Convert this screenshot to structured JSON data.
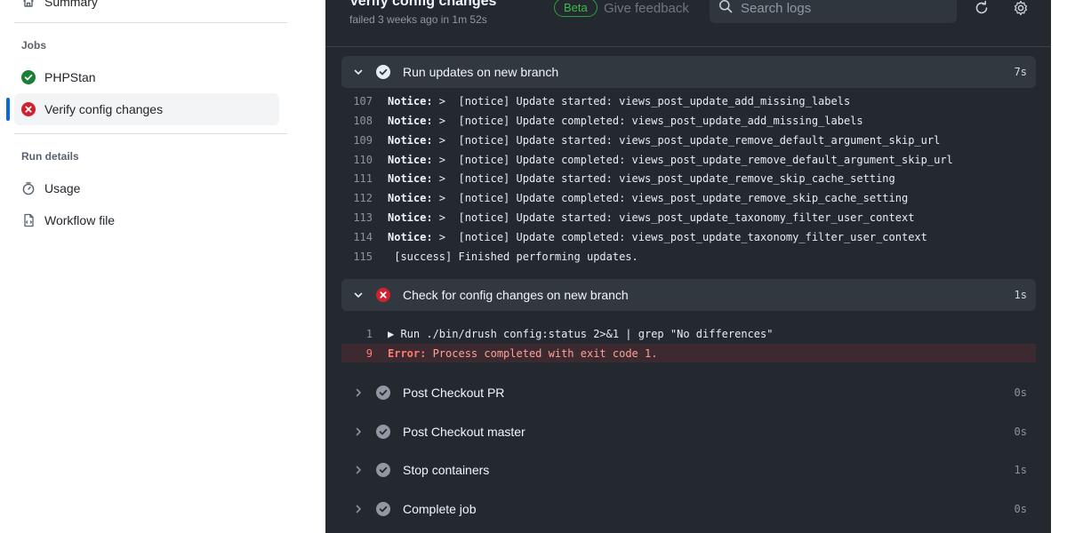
{
  "sidebar": {
    "summary_label": "Summary",
    "jobs_heading": "Jobs",
    "jobs": [
      {
        "label": "PHPStan",
        "status": "success"
      },
      {
        "label": "Verify config changes",
        "status": "failure"
      }
    ],
    "run_details_heading": "Run details",
    "details": [
      {
        "label": "Usage",
        "icon": "stopwatch-icon"
      },
      {
        "label": "Workflow file",
        "icon": "file-icon"
      }
    ]
  },
  "header": {
    "title": "Verify config changes",
    "subtitle": "failed 3 weeks ago in 1m 52s",
    "beta_label": "Beta",
    "feedback_label": "Give feedback",
    "search_placeholder": "Search logs"
  },
  "steps": [
    {
      "name": "Run updates on new branch",
      "status": "success",
      "duration": "7s",
      "lines": [
        {
          "n": "107",
          "label": "Notice:",
          "text": " >  [notice] Update started: views_post_update_add_missing_labels"
        },
        {
          "n": "108",
          "label": "Notice:",
          "text": " >  [notice] Update completed: views_post_update_add_missing_labels"
        },
        {
          "n": "109",
          "label": "Notice:",
          "text": " >  [notice] Update started: views_post_update_remove_default_argument_skip_url"
        },
        {
          "n": "110",
          "label": "Notice:",
          "text": " >  [notice] Update completed: views_post_update_remove_default_argument_skip_url"
        },
        {
          "n": "111",
          "label": "Notice:",
          "text": " >  [notice] Update started: views_post_update_remove_skip_cache_setting"
        },
        {
          "n": "112",
          "label": "Notice:",
          "text": " >  [notice] Update completed: views_post_update_remove_skip_cache_setting"
        },
        {
          "n": "113",
          "label": "Notice:",
          "text": " >  [notice] Update started: views_post_update_taxonomy_filter_user_context"
        },
        {
          "n": "114",
          "label": "Notice:",
          "text": " >  [notice] Update completed: views_post_update_taxonomy_filter_user_context"
        },
        {
          "n": "115",
          "label": "",
          "text": " [success] Finished performing updates."
        }
      ]
    },
    {
      "name": "Check for config changes on new branch",
      "status": "failure",
      "duration": "1s",
      "lines": [
        {
          "n": "1",
          "label": "",
          "text": "▶ Run ./bin/drush config:status 2>&1 | grep \"No differences\""
        },
        {
          "n": "9",
          "label": "Error:",
          "text": " Process completed with exit code 1.",
          "error": true
        }
      ]
    },
    {
      "name": "Post Checkout PR",
      "status": "neutral",
      "duration": "0s"
    },
    {
      "name": "Post Checkout master",
      "status": "neutral",
      "duration": "0s"
    },
    {
      "name": "Stop containers",
      "status": "neutral",
      "duration": "1s"
    },
    {
      "name": "Complete job",
      "status": "neutral",
      "duration": "0s"
    }
  ],
  "colors": {
    "success": "#1a7f37",
    "failure": "#cf222e",
    "accent": "#0969da",
    "log_background": "#24292f"
  }
}
